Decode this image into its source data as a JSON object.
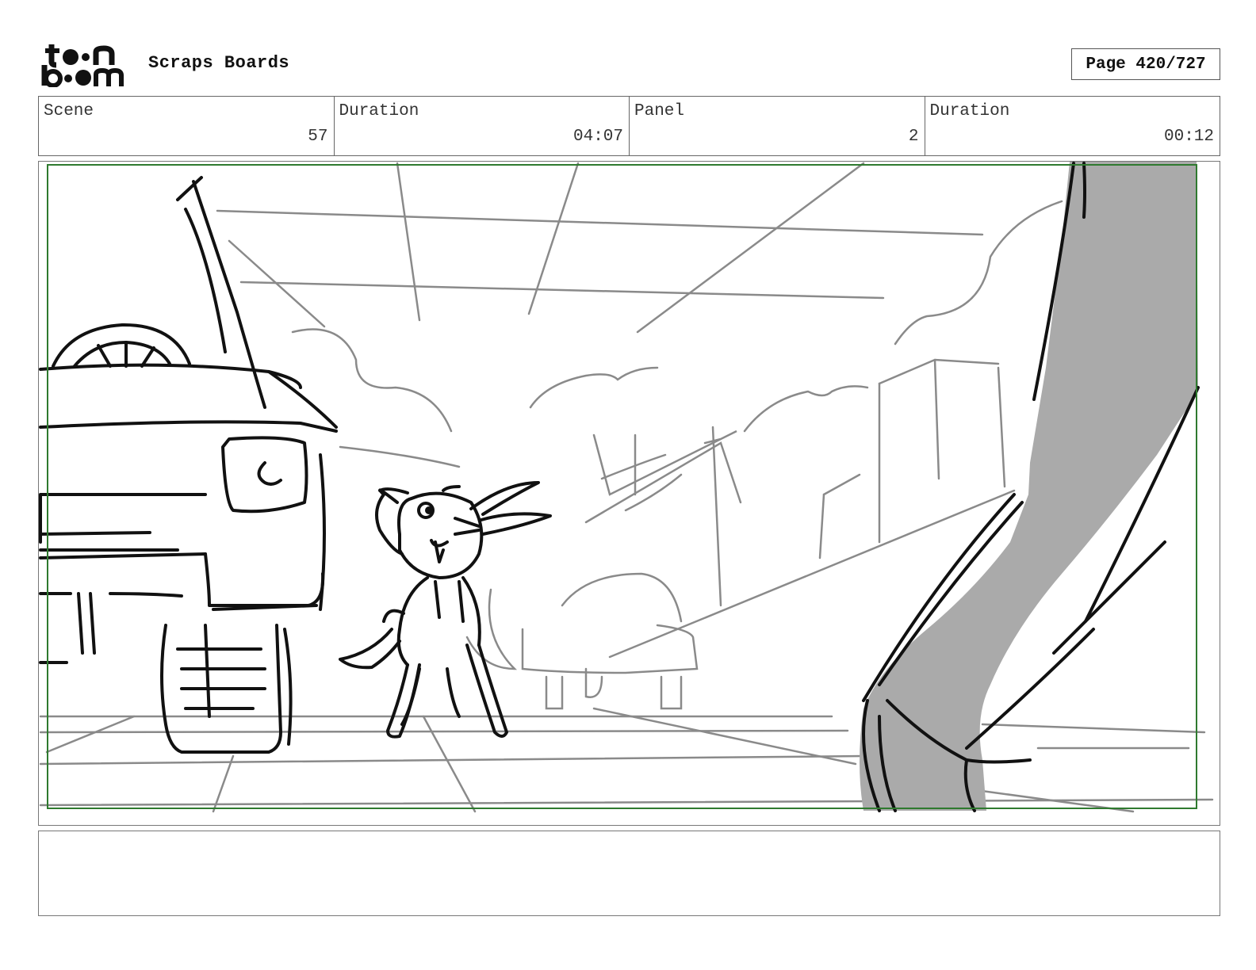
{
  "header": {
    "logo_text": "toon boom",
    "project_title": "Scraps Boards",
    "page_indicator": "Page 420/727"
  },
  "info": [
    {
      "label": "Scene",
      "value": "57"
    },
    {
      "label": "Duration",
      "value": "04:07"
    },
    {
      "label": "Panel",
      "value": "2"
    },
    {
      "label": "Duration",
      "value": "00:12"
    }
  ],
  "panel": {
    "safe_frame_color": "#2f7a2f",
    "sketch_color": "#111111",
    "construction_line_color": "#8a8a8a",
    "arm_fill_color": "#aaaaaa"
  },
  "notes": {
    "text": ""
  }
}
